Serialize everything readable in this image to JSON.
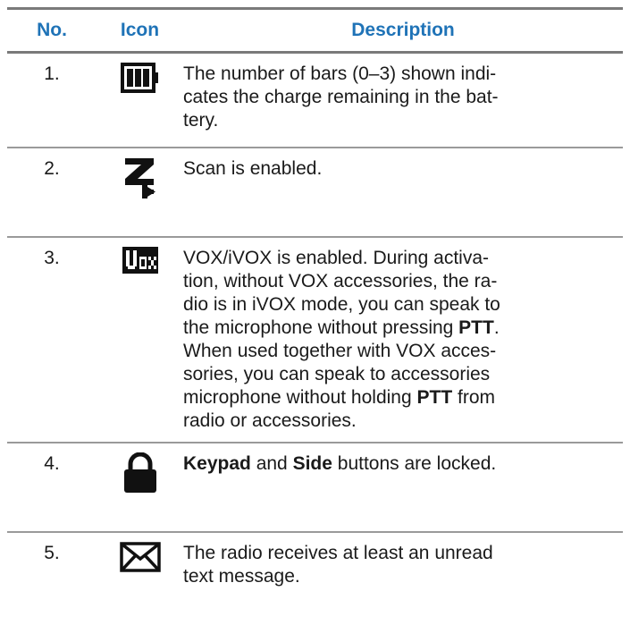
{
  "header": {
    "no": "No.",
    "icon": "Icon",
    "description": "Description"
  },
  "rows": [
    {
      "no": "1.",
      "icon": "battery-icon",
      "desc": [
        "The number of bars (0–3) shown indi-",
        "cates the charge remaining in the bat-",
        "tery."
      ]
    },
    {
      "no": "2.",
      "icon": "scan-icon",
      "desc": [
        "Scan is enabled."
      ]
    },
    {
      "no": "3.",
      "icon": "vox-icon",
      "desc_parts": {
        "l1": "VOX/iVOX is enabled. During activa-",
        "l2": "tion, without VOX accessories, the ra-",
        "l3": "dio is in iVOX mode, you can speak to",
        "l4a": "the microphone without pressing ",
        "l4b": "PTT",
        "l4c": ".",
        "l5": "When used together with VOX acces-",
        "l6": "sories, you can speak to accessories",
        "l7a": "microphone without holding ",
        "l7b": "PTT",
        "l7c": " from",
        "l8": "radio or accessories."
      }
    },
    {
      "no": "4.",
      "icon": "lock-icon",
      "desc_parts": {
        "a": "Keypad",
        "b": " and ",
        "c": "Side",
        "d": " buttons are locked."
      }
    },
    {
      "no": "5.",
      "icon": "envelope-icon",
      "desc": [
        "The radio receives at least an unread",
        "text message."
      ]
    }
  ],
  "colors": {
    "header_text": "#1f73b7",
    "rule": "#7a7a7a",
    "icon": "#111111"
  }
}
